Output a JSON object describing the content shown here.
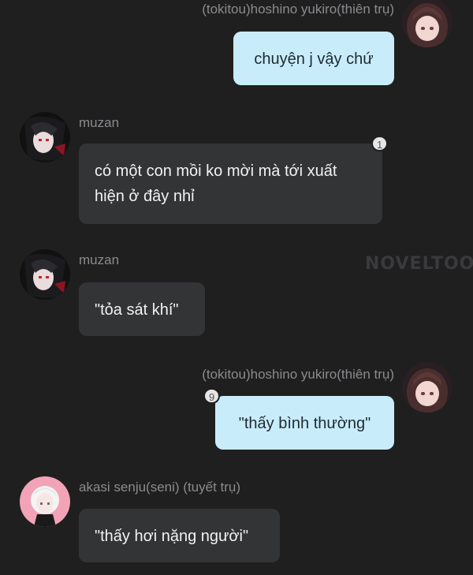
{
  "messages": [
    {
      "sender": "(tokitou)hoshino yukiro(thiên trụ)",
      "text": "chuyện j vậy chứ"
    },
    {
      "sender": "muzan",
      "text": "có một con mồi ko mời mà tới xuất hiện ở đây nhỉ",
      "badge": "1"
    },
    {
      "sender": "muzan",
      "text": "\"tỏa sát khí\""
    },
    {
      "sender": "(tokitou)hoshino yukiro(thiên trụ)",
      "text": "\"thấy bình thường\"",
      "badge": "9"
    },
    {
      "sender": "akasi senju(seni)  (tuyết trụ)",
      "text": "\"thấy hơi nặng người\""
    }
  ],
  "watermark": "NOVELTOON",
  "colors": {
    "background": "#1f1f20",
    "bubble_other": "#333436",
    "bubble_self": "#c9ecfb",
    "name_text": "#8b8b8e"
  },
  "icons": {
    "avatar_self": "avatar-girl-brown-hair",
    "avatar_muzan": "avatar-muzan-dark",
    "avatar_senju": "avatar-pink-white-hair"
  }
}
